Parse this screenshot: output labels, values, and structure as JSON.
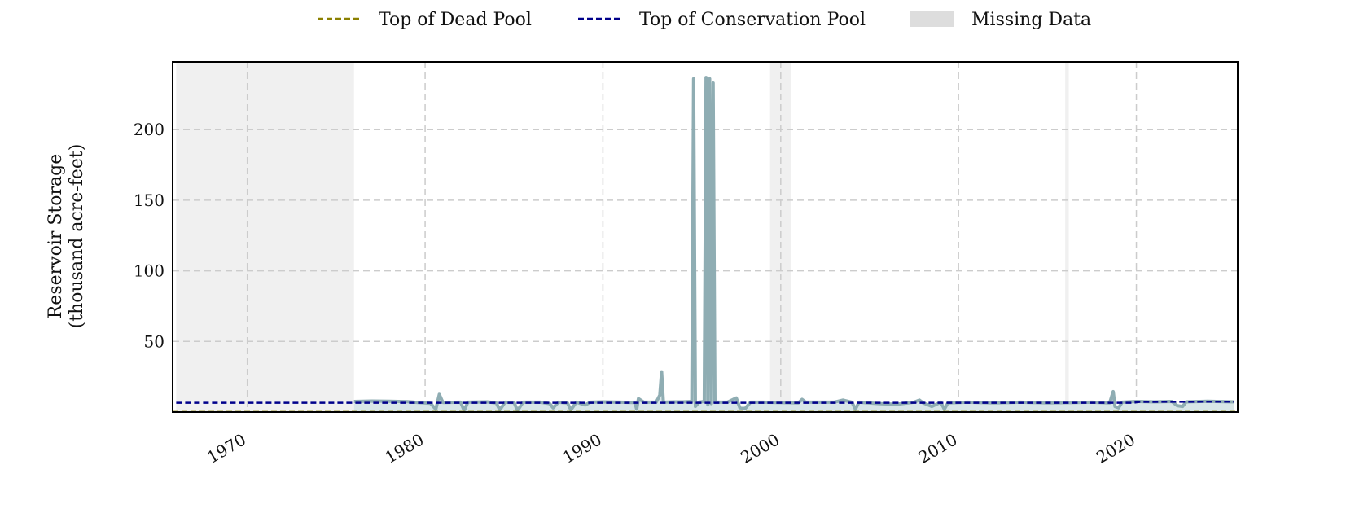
{
  "chart_data": {
    "type": "line",
    "title": "",
    "ylabel_lines": [
      "Reservoir Storage",
      "(thousand acre-feet)"
    ],
    "xlabel": "",
    "xlim": [
      1965.8,
      2025.7
    ],
    "ylim": [
      0,
      248
    ],
    "x_ticks": [
      1970,
      1980,
      1990,
      2000,
      2010,
      2020
    ],
    "y_ticks": [
      50,
      100,
      150,
      200
    ],
    "grid": true,
    "legend": {
      "placement": "top-center",
      "items": [
        {
          "label": "Top of Dead Pool",
          "style": "dashed",
          "color": "#8b8000"
        },
        {
          "label": "Top of Conservation Pool",
          "style": "dashed",
          "color": "#00008b"
        },
        {
          "label": "Missing Data",
          "style": "patch",
          "color": "#dddddd"
        }
      ]
    },
    "missing_ranges": [
      [
        1966.0,
        1976.0
      ],
      [
        1999.4,
        2000.6
      ],
      [
        2016.0,
        2016.2
      ]
    ],
    "dead_pool": {
      "name": "Top of Dead Pool",
      "color": "#8b8000",
      "value": 0.2
    },
    "conservation_pool": {
      "name": "Top of Conservation Pool",
      "color": "#00008b",
      "points": [
        [
          1966.0,
          6.6
        ],
        [
          2019.8,
          6.6
        ],
        [
          2020.2,
          7.2
        ],
        [
          2025.5,
          7.4
        ]
      ]
    },
    "series": [
      {
        "color": "#8fadb3",
        "fill_color": "#d8e6e8",
        "values": [
          [
            1976.0,
            7.5
          ],
          [
            1977.0,
            7.8
          ],
          [
            1978.0,
            7.6
          ],
          [
            1979.0,
            7.3
          ],
          [
            1980.3,
            6.2
          ],
          [
            1980.6,
            2.0
          ],
          [
            1980.8,
            12.5
          ],
          [
            1981.0,
            6.8
          ],
          [
            1982.0,
            7.0
          ],
          [
            1982.2,
            1.0
          ],
          [
            1982.4,
            7.0
          ],
          [
            1983.5,
            7.2
          ],
          [
            1984.0,
            6.5
          ],
          [
            1984.2,
            1.5
          ],
          [
            1984.5,
            7.0
          ],
          [
            1985.0,
            6.8
          ],
          [
            1985.2,
            1.0
          ],
          [
            1985.5,
            7.0
          ],
          [
            1986.5,
            7.0
          ],
          [
            1987.0,
            6.0
          ],
          [
            1987.2,
            3.0
          ],
          [
            1987.5,
            7.0
          ],
          [
            1988.0,
            6.5
          ],
          [
            1988.2,
            1.5
          ],
          [
            1988.5,
            7.0
          ],
          [
            1989.0,
            5.0
          ],
          [
            1989.3,
            7.0
          ],
          [
            1990.0,
            7.2
          ],
          [
            1991.0,
            7.0
          ],
          [
            1991.8,
            6.8
          ],
          [
            1991.9,
            2.0
          ],
          [
            1992.0,
            9.5
          ],
          [
            1992.3,
            7.0
          ],
          [
            1993.0,
            7.0
          ],
          [
            1993.2,
            12.0
          ],
          [
            1993.3,
            28.5
          ],
          [
            1993.4,
            7.0
          ],
          [
            1994.0,
            7.2
          ],
          [
            1994.5,
            7.2
          ],
          [
            1995.0,
            7.5
          ],
          [
            1995.1,
            236.0
          ],
          [
            1995.2,
            4.0
          ],
          [
            1995.4,
            7.0
          ],
          [
            1995.7,
            7.5
          ],
          [
            1995.8,
            237.0
          ],
          [
            1995.9,
            5.0
          ],
          [
            1996.0,
            236.0
          ],
          [
            1996.1,
            6.0
          ],
          [
            1996.2,
            233.0
          ],
          [
            1996.3,
            7.0
          ],
          [
            1997.0,
            7.0
          ],
          [
            1997.5,
            10.0
          ],
          [
            1997.7,
            3.0
          ],
          [
            1998.0,
            2.5
          ],
          [
            1998.3,
            7.0
          ],
          [
            1999.0,
            7.0
          ],
          [
            2001.0,
            6.5
          ],
          [
            2001.2,
            9.0
          ],
          [
            2001.4,
            7.0
          ],
          [
            2003.0,
            7.0
          ],
          [
            2003.5,
            8.5
          ],
          [
            2004.0,
            7.0
          ],
          [
            2004.2,
            2.0
          ],
          [
            2004.4,
            7.0
          ],
          [
            2005.5,
            6.0
          ],
          [
            2006.5,
            5.5
          ],
          [
            2007.5,
            7.0
          ],
          [
            2007.8,
            8.5
          ],
          [
            2008.0,
            6.5
          ],
          [
            2008.5,
            4.0
          ],
          [
            2009.0,
            7.0
          ],
          [
            2009.2,
            2.0
          ],
          [
            2009.4,
            6.5
          ],
          [
            2010.5,
            7.0
          ],
          [
            2012.0,
            6.5
          ],
          [
            2013.5,
            7.0
          ],
          [
            2015.0,
            6.5
          ],
          [
            2016.5,
            6.8
          ],
          [
            2017.5,
            7.0
          ],
          [
            2018.5,
            6.5
          ],
          [
            2018.7,
            14.5
          ],
          [
            2018.8,
            4.0
          ],
          [
            2019.0,
            3.0
          ],
          [
            2019.2,
            7.0
          ],
          [
            2020.0,
            7.5
          ],
          [
            2021.0,
            7.2
          ],
          [
            2022.0,
            7.5
          ],
          [
            2022.3,
            4.5
          ],
          [
            2022.6,
            4.0
          ],
          [
            2022.8,
            7.2
          ],
          [
            2024.0,
            7.6
          ],
          [
            2025.0,
            7.4
          ],
          [
            2025.5,
            7.2
          ]
        ]
      }
    ]
  }
}
